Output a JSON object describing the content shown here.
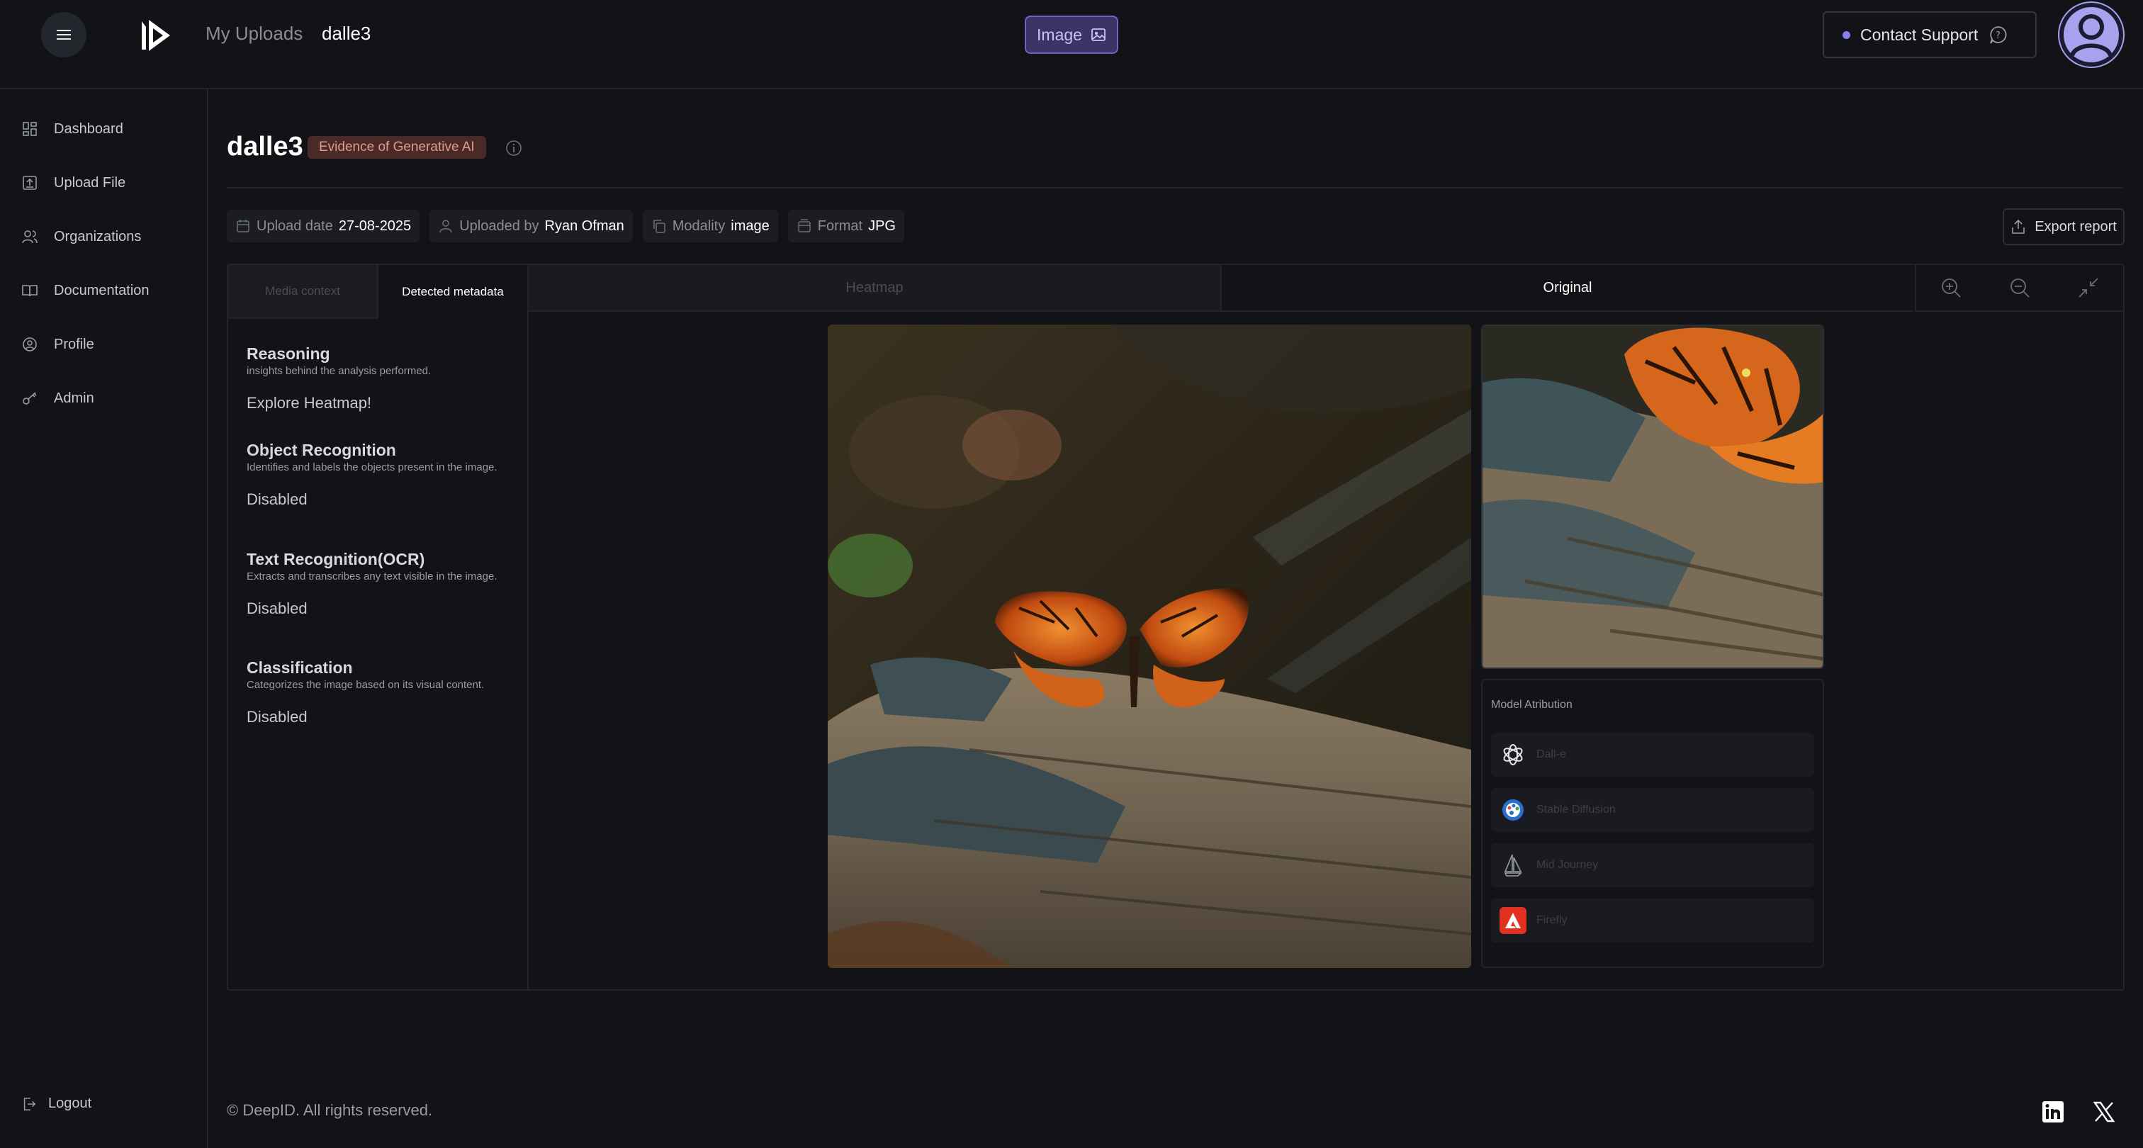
{
  "header": {
    "breadcrumb_parent": "My Uploads",
    "breadcrumb_current": "dalle3",
    "media_type": "Image",
    "support_label": "Contact Support"
  },
  "sidebar": {
    "items": [
      {
        "label": "Dashboard",
        "icon": "dashboard-icon"
      },
      {
        "label": "Upload File",
        "icon": "upload-icon"
      },
      {
        "label": "Organizations",
        "icon": "users-icon"
      },
      {
        "label": "Documentation",
        "icon": "book-icon"
      },
      {
        "label": "Profile",
        "icon": "user-circle-icon"
      },
      {
        "label": "Admin",
        "icon": "key-icon"
      }
    ],
    "logout": "Logout"
  },
  "main": {
    "title": "dalle3",
    "badge": "Evidence of Generative AI",
    "meta": [
      {
        "key": "Upload date",
        "value": "27-08-2025",
        "icon": "calendar-icon"
      },
      {
        "key": "Uploaded by",
        "value": "Ryan Ofman",
        "icon": "user-icon"
      },
      {
        "key": "Modality",
        "value": "image",
        "icon": "copy-icon"
      },
      {
        "key": "Format",
        "value": "JPG",
        "icon": "file-icon"
      }
    ],
    "export_label": "Export report",
    "left_tabs": [
      "Media context",
      "Detected metadata"
    ],
    "sections": [
      {
        "title": "Reasoning",
        "desc": "insights behind the analysis performed.",
        "value": "Explore Heatmap!"
      },
      {
        "title": "Object Recognition",
        "desc": "Identifies and labels the objects present in the image.",
        "value": "Disabled"
      },
      {
        "title": "Text Recognition(OCR)",
        "desc": "Extracts and transcribes any text visible in the image.",
        "value": "Disabled"
      },
      {
        "title": "Classification",
        "desc": "Categorizes the image based on its visual content.",
        "value": "Disabled"
      }
    ],
    "view_tabs": [
      "Heatmap",
      "Original"
    ],
    "attribution": {
      "title": "Model Atribution",
      "models": [
        "Dall-e",
        "Stable Diffusion",
        "Mid Journey",
        "Firefly"
      ]
    }
  },
  "footer": {
    "copyright": "© DeepID. All rights reserved."
  },
  "colors": {
    "background": "#121317",
    "accent": "#8a7df0",
    "badge_bg": "#4a2a28",
    "badge_text": "#e29a8e"
  }
}
